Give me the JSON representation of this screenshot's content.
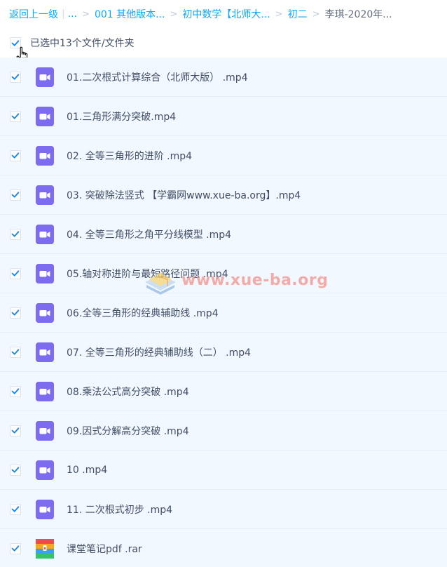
{
  "breadcrumb": {
    "back": "返回上一级",
    "ellipsis": "...",
    "items": [
      "001 其他版本...",
      "初中数学【北师大...",
      "初二"
    ],
    "current": "李琪-2020年...",
    "separator": ">",
    "pipe": "|"
  },
  "selection": {
    "text": "已选中13个文件/文件夹",
    "checked": true
  },
  "files": [
    {
      "name": "01.二次根式计算综合（北师大版） .mp4",
      "type": "video",
      "checked": true
    },
    {
      "name": "01.三角形满分突破.mp4",
      "type": "video",
      "checked": true
    },
    {
      "name": "02. 全等三角形的进阶 .mp4",
      "type": "video",
      "checked": true
    },
    {
      "name": "03. 突破除法竖式 【学霸网www.xue-ba.org】.mp4",
      "type": "video",
      "checked": true
    },
    {
      "name": "04. 全等三角形之角平分线模型 .mp4",
      "type": "video",
      "checked": true
    },
    {
      "name": "05.轴对称进阶与最短路径问题 .mp4",
      "type": "video",
      "checked": true
    },
    {
      "name": "06.全等三角形的经典辅助线 .mp4",
      "type": "video",
      "checked": true
    },
    {
      "name": "07. 全等三角形的经典辅助线（二） .mp4",
      "type": "video",
      "checked": true
    },
    {
      "name": "08.乘法公式高分突破 .mp4",
      "type": "video",
      "checked": true
    },
    {
      "name": "09.因式分解高分突破 .mp4",
      "type": "video",
      "checked": true
    },
    {
      "name": "10 .mp4",
      "type": "video",
      "checked": true
    },
    {
      "name": "11. 二次根式初步 .mp4",
      "type": "video",
      "checked": true
    },
    {
      "name": "课堂笔记pdf .rar",
      "type": "archive",
      "checked": true
    }
  ],
  "watermark": {
    "text": "www.xue-ba.org"
  },
  "colors": {
    "accent": "#09aaff",
    "row_bg": "#f2f8ff",
    "video_icon": "#7d6cf0",
    "check": "#1c87ec"
  }
}
